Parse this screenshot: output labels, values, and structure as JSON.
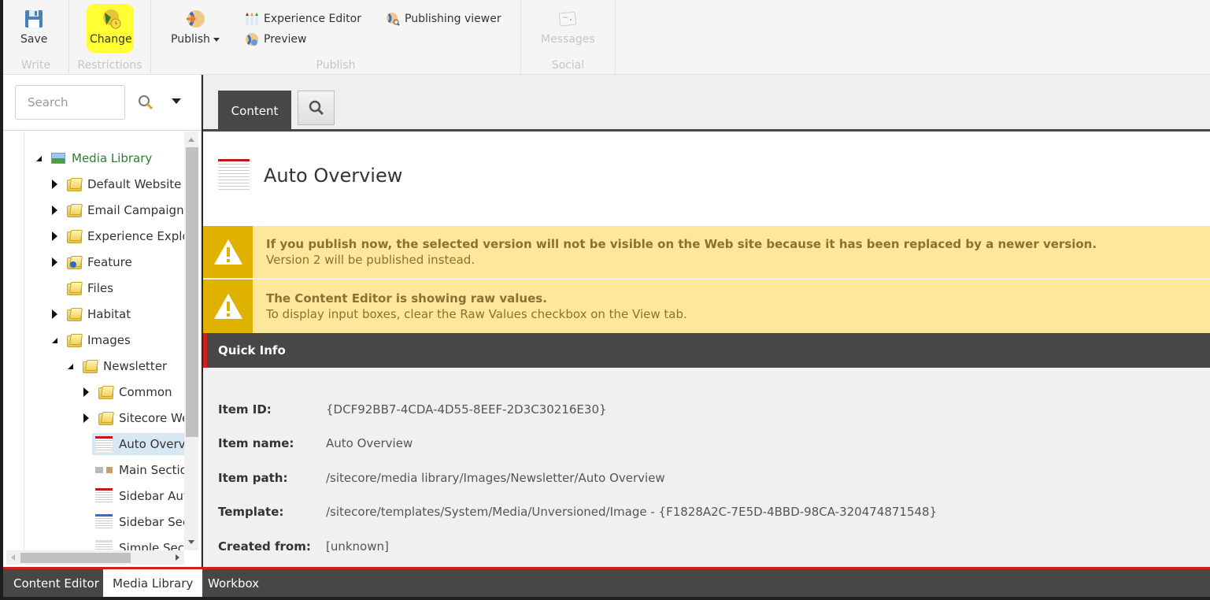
{
  "ribbon": {
    "groups": [
      {
        "label": "Write",
        "buttons": [
          {
            "label": "Save",
            "icon": "save-icon"
          }
        ]
      },
      {
        "label": "Restrictions",
        "buttons": [
          {
            "label": "Change",
            "icon": "change-restrictions-icon",
            "highlighted": true
          }
        ]
      },
      {
        "label": "Publish",
        "buttons": [
          {
            "label": "Publish",
            "icon": "publish-icon",
            "has_dropdown": true
          },
          {
            "label": "Experience Editor",
            "icon": "experience-editor-icon"
          },
          {
            "label": "Preview",
            "icon": "preview-icon"
          },
          {
            "label": "Publishing viewer",
            "icon": "publishing-viewer-icon"
          }
        ]
      },
      {
        "label": "Social",
        "buttons": [
          {
            "label": "Messages",
            "icon": "messages-icon",
            "disabled": true
          }
        ]
      }
    ]
  },
  "left_pane": {
    "search": {
      "placeholder": "Search",
      "value": ""
    },
    "tree": [
      {
        "label": "Media Library",
        "state": "expanded",
        "icon": "media-library-icon",
        "level": 0
      },
      {
        "label": "Default Website",
        "state": "collapsed",
        "icon": "folder-icon",
        "level": 1
      },
      {
        "label": "Email Campaign",
        "state": "collapsed",
        "icon": "folder-icon",
        "level": 1
      },
      {
        "label": "Experience Explor",
        "state": "collapsed",
        "icon": "folder-icon",
        "level": 1
      },
      {
        "label": "Feature",
        "state": "collapsed",
        "icon": "folder-user-icon",
        "level": 1
      },
      {
        "label": "Files",
        "state": "none",
        "icon": "folder-icon",
        "level": 1
      },
      {
        "label": "Habitat",
        "state": "collapsed",
        "icon": "folder-icon",
        "level": 1
      },
      {
        "label": "Images",
        "state": "expanded",
        "icon": "folder-icon",
        "level": 1
      },
      {
        "label": "Newsletter",
        "state": "expanded",
        "icon": "folder-icon",
        "level": 2
      },
      {
        "label": "Common",
        "state": "collapsed",
        "icon": "folder-icon",
        "level": 3
      },
      {
        "label": "Sitecore We",
        "state": "collapsed",
        "icon": "folder-icon",
        "level": 3
      },
      {
        "label": "Auto Overvi",
        "state": "none",
        "icon": "image-thumbnail-icon",
        "level": 3,
        "selected": true
      },
      {
        "label": "Main Sectio",
        "state": "none",
        "icon": "image-thumbnail-icon",
        "level": 3
      },
      {
        "label": "Sidebar Auto",
        "state": "none",
        "icon": "image-thumbnail-icon",
        "level": 3
      },
      {
        "label": "Sidebar Sect",
        "state": "none",
        "icon": "image-thumbnail-icon",
        "level": 3
      },
      {
        "label": "Simple Secti",
        "state": "none",
        "icon": "image-thumbnail-icon",
        "level": 3
      }
    ]
  },
  "editor": {
    "tabs": [
      {
        "label": "Content",
        "active": true
      },
      {
        "label": "Search",
        "icon": "search-icon"
      }
    ],
    "item_title": "Auto Overview",
    "warnings": [
      {
        "title": "If you publish now, the selected version will not be visible on the Web site because it has been replaced by a newer version.",
        "text": "Version 2 will be published instead."
      },
      {
        "title": "The Content Editor is showing raw values.",
        "text": "To display input boxes, clear the Raw Values checkbox on the View tab."
      }
    ],
    "section_title": "Quick Info",
    "quick_info": [
      {
        "label": "Item ID:",
        "value": "{DCF92BB7-4CDA-4D55-8EEF-2D3C30216E30}"
      },
      {
        "label": "Item name:",
        "value": "Auto Overview"
      },
      {
        "label": "Item path:",
        "value": "/sitecore/media library/Images/Newsletter/Auto Overview"
      },
      {
        "label": "Template:",
        "value": "/sitecore/templates/System/Media/Unversioned/Image - {F1828A2C-7E5D-4BBD-98CA-320474871548}"
      },
      {
        "label": "Created from:",
        "value": "[unknown]"
      }
    ]
  },
  "bottom_tabs": [
    {
      "label": "Content Editor",
      "active": false
    },
    {
      "label": "Media Library",
      "active": true
    },
    {
      "label": "Workbox",
      "active": false
    }
  ],
  "colors": {
    "accent_red": "#d1201a",
    "warning_bg": "#fce79a",
    "warning_icon_bg": "#e0b200",
    "dark_bar": "#474747",
    "highlight": "#ffff33"
  }
}
